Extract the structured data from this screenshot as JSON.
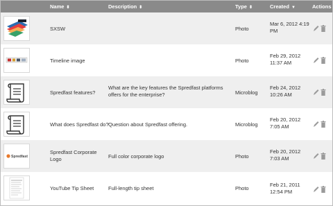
{
  "header": {
    "name": "Name",
    "description": "Description",
    "type": "Type",
    "created": "Created",
    "actions": "Actions"
  },
  "rows": [
    {
      "thumb": "colorful-layered-logo",
      "name": "SXSW",
      "description": "",
      "type": "Photo",
      "created": "Mar 6, 2012 4:19 PM"
    },
    {
      "thumb": "timeline-strip",
      "name": "Timeline image",
      "description": "",
      "type": "Photo",
      "created": "Feb 29, 2012 11:37 AM"
    },
    {
      "thumb": "scroll-icon",
      "name": "Spredfast features?",
      "description": "What are the key features the Spredfast platforms offers for the enterprise?",
      "type": "Microblog",
      "created": "Feb 24, 2012 10:26 AM"
    },
    {
      "thumb": "scroll-icon",
      "name": "What does Spredfast do?",
      "description": "Question about Spredfast offering.",
      "type": "Microblog",
      "created": "Feb 20, 2012 7:05 AM"
    },
    {
      "thumb": "spredfast-logo",
      "name": "Spredfast Corporate Logo",
      "description": "Full color corporate logo",
      "type": "Photo",
      "created": "Feb 20, 2012 7:03 AM",
      "logo_text": "Spredfast"
    },
    {
      "thumb": "document-page",
      "name": "YouTube Tip Sheet",
      "description": "Full-length tip sheet",
      "type": "Photo",
      "created": "Feb 21, 2011 12:54 PM"
    }
  ],
  "icons": {
    "sort": "sort-up-down-icon",
    "sort_active": "sort-down-icon",
    "edit": "pencil-icon",
    "delete": "trash-icon"
  },
  "colors": {
    "header_bg": "#8a8a8a",
    "row_alt": "#efefef",
    "logo_orange": "#e8792b"
  }
}
